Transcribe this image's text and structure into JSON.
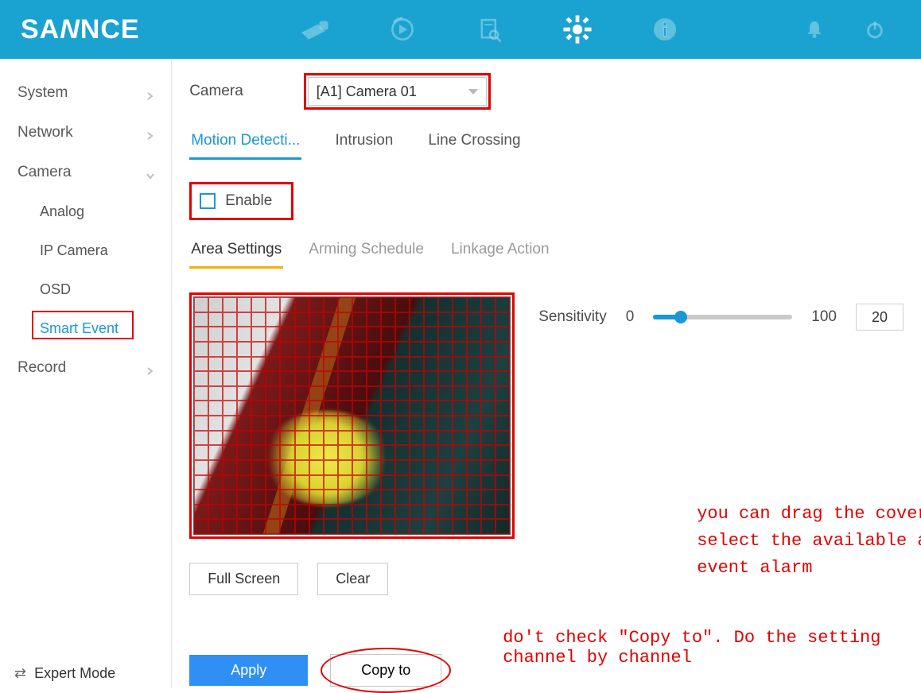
{
  "brand": "SANNCE",
  "sidebar": {
    "items": [
      {
        "label": "System",
        "expandable": true
      },
      {
        "label": "Network",
        "expandable": true
      },
      {
        "label": "Camera",
        "expandable": true,
        "expanded": true
      },
      {
        "label": "Record",
        "expandable": true
      }
    ],
    "camera_children": [
      {
        "label": "Analog"
      },
      {
        "label": "IP Camera"
      },
      {
        "label": "OSD"
      },
      {
        "label": "Smart Event",
        "active": true
      }
    ],
    "expert_mode": "Expert Mode"
  },
  "camera_selector": {
    "label": "Camera",
    "value": "[A1] Camera 01"
  },
  "event_tabs": {
    "motion": "Motion Detecti...",
    "intrusion": "Intrusion",
    "line": "Line Crossing"
  },
  "enable_label": "Enable",
  "sub_tabs": {
    "area": "Area Settings",
    "arming": "Arming Schedule",
    "linkage": "Linkage Action"
  },
  "sensitivity": {
    "label": "Sensitivity",
    "min": "0",
    "max": "100",
    "value": "20"
  },
  "buttons": {
    "full_screen": "Full Screen",
    "clear": "Clear",
    "apply": "Apply",
    "copy_to": "Copy to"
  },
  "annotations": {
    "drag_hint": "you can drag the coverage to\nselect the available area for\nevent alarm",
    "copy_hint": "do't check \"Copy to\". Do the setting channel by channel"
  },
  "topbar_icons": {
    "live": "live-view-icon",
    "playback": "playback-icon",
    "search": "file-search-icon",
    "settings": "settings-icon",
    "info": "info-icon",
    "alert": "bell-icon",
    "power": "power-icon"
  }
}
